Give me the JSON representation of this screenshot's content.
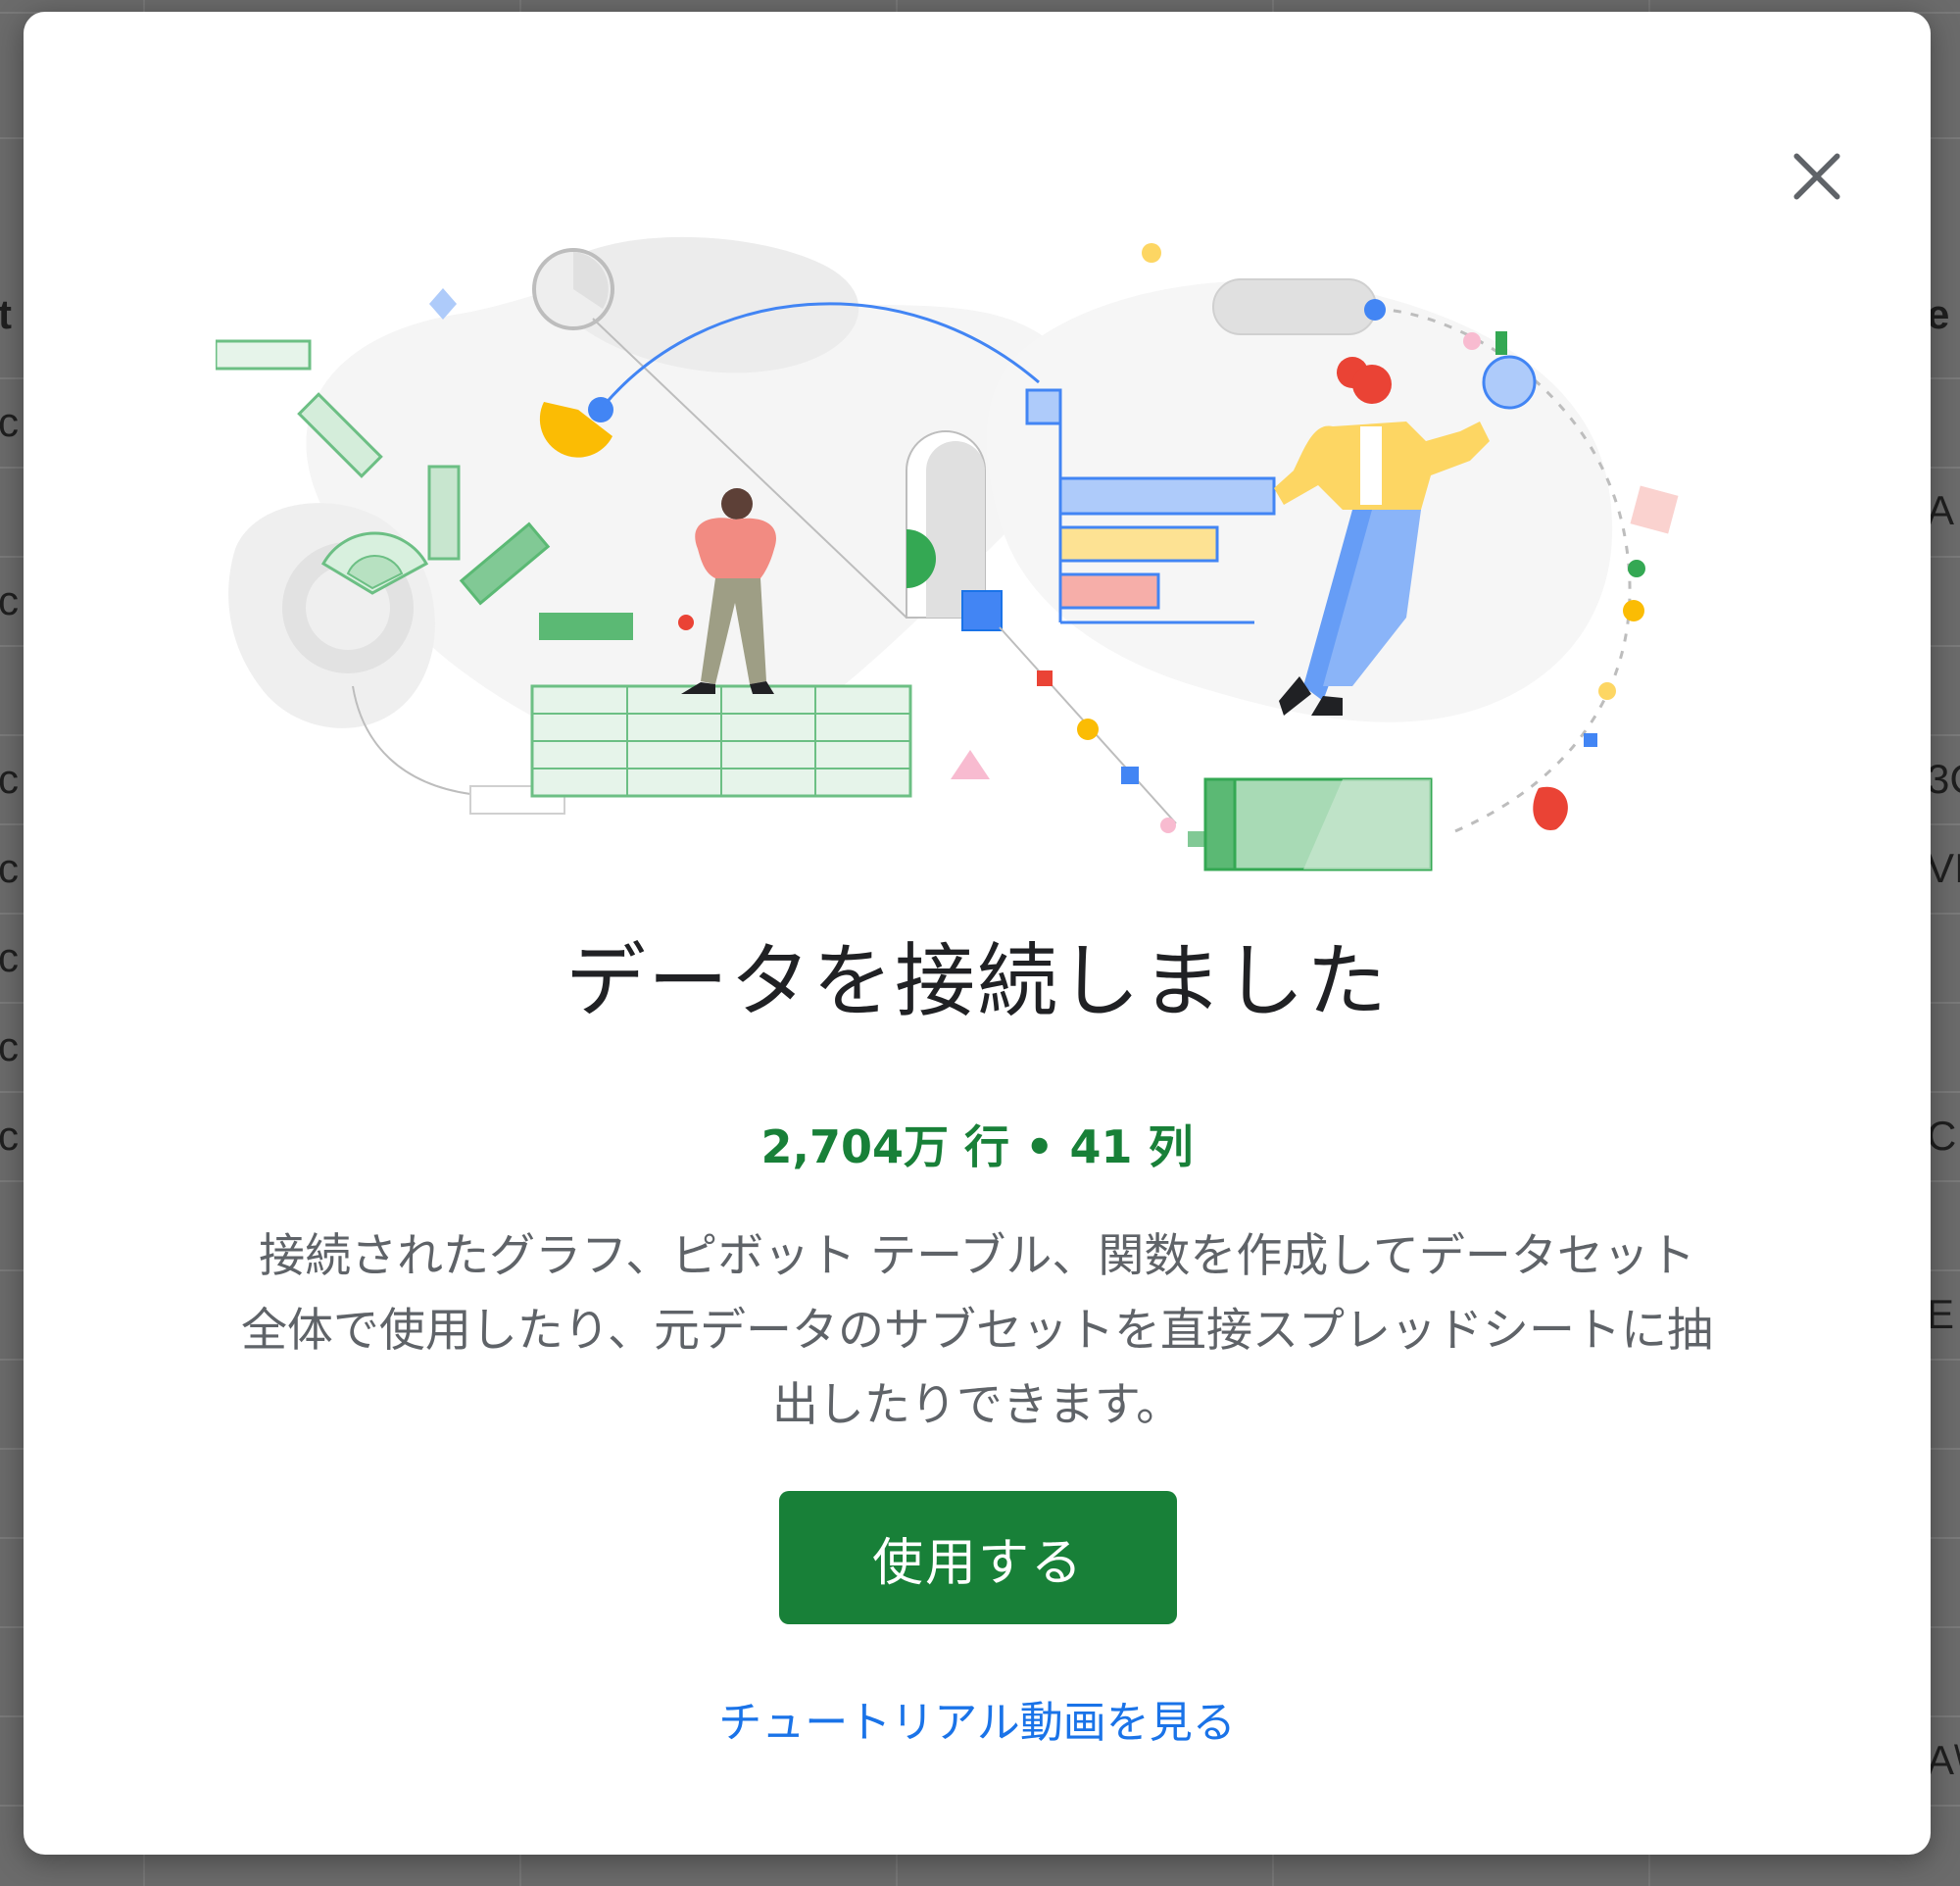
{
  "background_sheet": {
    "left_column_fragments": [
      "t",
      "c",
      "c",
      "c",
      "c",
      "c",
      "c",
      "c"
    ],
    "right_column_fragments": [
      "e",
      "A",
      "3C",
      "VI",
      "C",
      "E",
      "A\\"
    ]
  },
  "dialog": {
    "close_icon": "close-icon",
    "title": "データを接続しました",
    "stats": "2,704万 行 • 41 列",
    "description": "接続されたグラフ、ピボット テーブル、関数を作成してデータセット全体で使用したり、元データのサブセットを直接スプレッドシートに抽出したりできます。",
    "primary_button": "使用する",
    "tutorial_link": "チュートリアル動画を見る"
  },
  "colors": {
    "accent_green": "#188038",
    "link_blue": "#1a73e8",
    "title_text": "#202124",
    "body_text": "#5f6368"
  }
}
